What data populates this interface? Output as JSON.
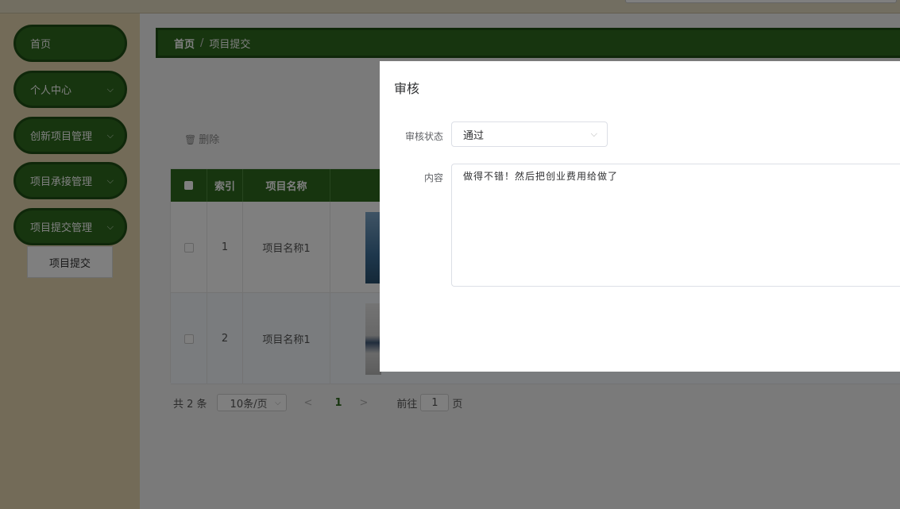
{
  "topbar": {},
  "sidebar": {
    "items": [
      {
        "label": "首页",
        "has_chevron": false
      },
      {
        "label": "个人中心",
        "has_chevron": true
      },
      {
        "label": "创新项目管理",
        "has_chevron": true
      },
      {
        "label": "项目承接管理",
        "has_chevron": true
      },
      {
        "label": "项目提交管理",
        "has_chevron": true
      }
    ],
    "submenu_item": "项目提交"
  },
  "breadcrumb": {
    "home": "首页",
    "separator": "/",
    "current": "项目提交"
  },
  "toolbar": {
    "delete_label": "删除"
  },
  "table": {
    "headers": {
      "index": "索引",
      "name": "项目名称"
    },
    "rows": [
      {
        "index": "1",
        "name": "项目名称1"
      },
      {
        "index": "2",
        "name": "项目名称1"
      }
    ]
  },
  "pagination": {
    "total_text": "共 2 条",
    "page_size": "10条/页",
    "current_page": "1",
    "goto_label": "前往",
    "goto_value": "1",
    "page_word": "页"
  },
  "dialog": {
    "title": "审核",
    "status_label": "审核状态",
    "status_value": "通过",
    "content_label": "内容",
    "content_value": "做得不错！然后把创业费用给做了"
  },
  "colors": {
    "primary_green": "#2e6b1f",
    "sidebar_bg": "#e6d7b0"
  }
}
